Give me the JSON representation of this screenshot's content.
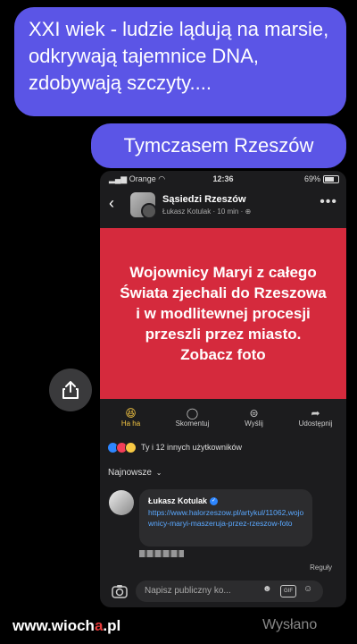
{
  "chat": {
    "message1": "XXI wiek - ludzie lądują na marsie, odkrywają tajemnice DNA, zdobywają szczyty....",
    "message2": "Tymczasem Rzeszów",
    "status": "Wysłano",
    "watermark_pre": "www.wioch",
    "watermark_dot": "a",
    "watermark_post": ".pl"
  },
  "phone": {
    "carrier": "Orange",
    "time": "12:36",
    "battery": "69%",
    "group_name": "Sąsiedzi Rzeszów",
    "post_meta": "Łukasz Kotulak · 10 min ·",
    "banner_text": "Wojownicy Maryi z całego Świata zjechali do Rzeszowa i w modlitewnej procesji przeszli przez miasto. Zobacz foto",
    "actions": [
      {
        "icon": "haha",
        "label": "Ha ha"
      },
      {
        "icon": "comment",
        "label": "Skomentuj"
      },
      {
        "icon": "messenger",
        "label": "Wyślij"
      },
      {
        "icon": "share",
        "label": "Udostępnij"
      }
    ],
    "reactions_text": "Ty i 12 innych użytkowników",
    "sort_label": "Najnowsze",
    "comment": {
      "author": "Łukasz Kotulak",
      "link": "https://www.halorzeszow.pl/artykul/11062,wojownicy-maryi-maszeruja-przez-rzeszow-foto"
    },
    "rules_label": "Reguły",
    "composer_placeholder": "Napisz publiczny ko...",
    "gif_label": "GIF"
  },
  "colors": {
    "bubble": "#5b55e6",
    "banner": "#d52a3d",
    "haha": "#f4c542",
    "link": "#5aa8ff"
  }
}
